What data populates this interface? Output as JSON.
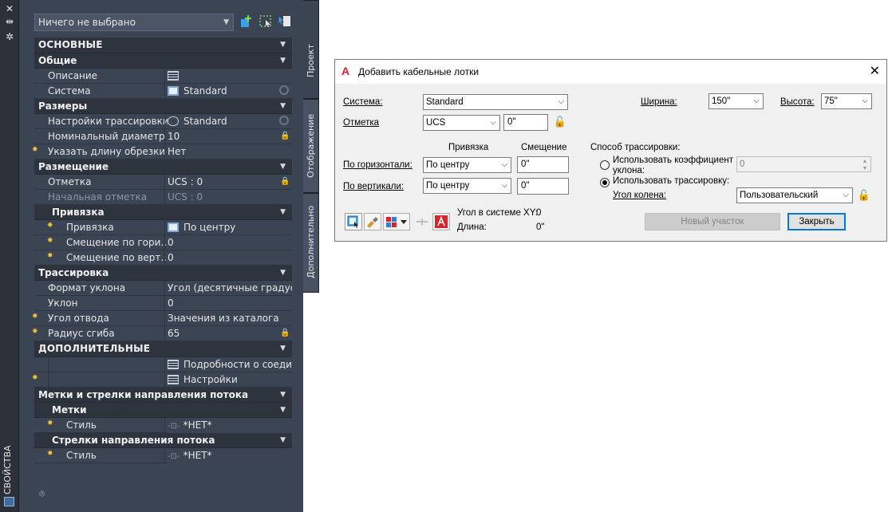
{
  "palette": {
    "title": "СВОЙСТВА",
    "selection": "Ничего не выбрано",
    "tabs": [
      "Проект",
      "Отображение",
      "Дополнительно"
    ],
    "sections": {
      "main": "ОСНОВНЫЕ",
      "general": "Общие",
      "description": "Описание",
      "system_label": "Система",
      "system_value": "Standard",
      "sizes": "Размеры",
      "routing_settings_label": "Настройки трассировки",
      "routing_settings_value": "Standard",
      "nominal_diameter_label": "Номинальный диаметр",
      "nominal_diameter_value": "10",
      "cut_length_label": "Указать длину обрезки",
      "cut_length_value": "Нет",
      "placement": "Размещение",
      "elevation_label": "Отметка",
      "elevation_value": "UCS : 0",
      "start_elevation_label": "Начальная отметка",
      "start_elevation_value": "UCS : 0",
      "justify": "Привязка",
      "justify_label": "Привязка",
      "justify_value": "По центру",
      "offset_h_label": "Смещение по гори...",
      "offset_h_value": "0",
      "offset_v_label": "Смещение по верт...",
      "offset_v_value": "0",
      "routing": "Трассировка",
      "slope_format_label": "Формат уклона",
      "slope_format_value": "Угол (десятичные градусы)",
      "slope_label": "Уклон",
      "slope_value": "0",
      "branch_angle_label": "Угол отвода",
      "branch_angle_value": "Значения из каталога",
      "bend_radius_label": "Радиус сгиба",
      "bend_radius_value": "65",
      "advanced": "ДОПОЛНИТЕЛЬНЫЕ",
      "connection_details": "Подробности о соеди...",
      "settings": "Настройки",
      "labels_flow": "Метки и стрелки направления потока",
      "labels": "Метки",
      "style_label_1": "Стиль",
      "style_value_1": "*НЕТ*",
      "flow_arrows": "Стрелки направления потока",
      "style_label_2": "Стиль",
      "style_value_2": "*НЕТ*"
    }
  },
  "dialog": {
    "title": "Добавить кабельные лотки",
    "system_label": "Система:",
    "system_value": "Standard",
    "elevation_label": "Отметка",
    "elevation_ref": "UCS",
    "elevation_value": "0\"",
    "width_label": "Ширина:",
    "width_value": "150\"",
    "height_label": "Высота:",
    "height_value": "75\"",
    "justify_header": "Привязка",
    "offset_header": "Смещение",
    "horizontal_label": "По горизонтали:",
    "horizontal_justify": "По центру",
    "horizontal_offset": "0\"",
    "vertical_label": "По вертикали:",
    "vertical_justify": "По центру",
    "vertical_offset": "0\"",
    "routing_method_label": "Способ трассировки:",
    "use_slope_label": "Использовать коэффициент уклона:",
    "slope_value": "0",
    "use_routing_label": "Использовать трассировку:",
    "elbow_angle_label": "Угол колена:",
    "elbow_angle_value": "Пользовательский",
    "xy_angle_label": "Угол в системе XY:",
    "xy_angle_value": "0",
    "length_label": "Длина:",
    "length_value": "0\"",
    "new_segment_button": "Новый участок",
    "close_button": "Закрыть"
  }
}
